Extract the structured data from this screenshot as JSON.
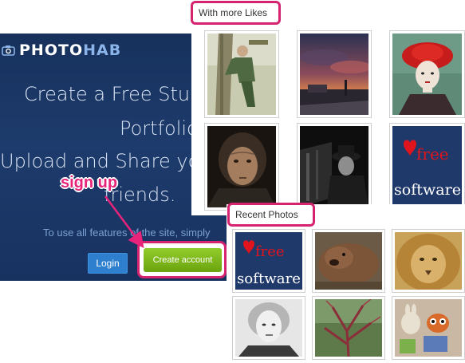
{
  "brand": {
    "logo_part1": "PHOTO",
    "logo_part2": "HAB",
    "logo_icon": "camera-icon"
  },
  "hero": {
    "line1": "Create a Free Stun",
    "line2": "Portfolio",
    "line3": "Upload and Share you",
    "line4": "friends.",
    "features_note": "To use all features of the site, simply"
  },
  "buttons": {
    "login": "Login",
    "create_account": "Create account"
  },
  "annotations": {
    "sign_up": "sign up"
  },
  "likes_section": {
    "title": "With more Likes",
    "photos": [
      {
        "subject": "man climbing tree"
      },
      {
        "subject": "sunset over street"
      },
      {
        "subject": "woman with red hat"
      },
      {
        "subject": "old woman portrait"
      },
      {
        "subject": "man in hat"
      },
      {
        "subject": "free software logo"
      }
    ]
  },
  "recent_section": {
    "title": "Recent Photos",
    "photos": [
      {
        "subject": "free software logo"
      },
      {
        "subject": "bear"
      },
      {
        "subject": "lion"
      },
      {
        "subject": "woman portrait"
      },
      {
        "subject": "tree branches"
      },
      {
        "subject": "toys"
      }
    ]
  },
  "fs_logo": {
    "line1": "free",
    "line2": "software"
  },
  "colors": {
    "highlight": "#d6236f",
    "signup_text": "#e8237a",
    "hero_bg": "#1d3b6c",
    "login_blue": "#2e7fce",
    "create_green": "#7bb51b"
  }
}
